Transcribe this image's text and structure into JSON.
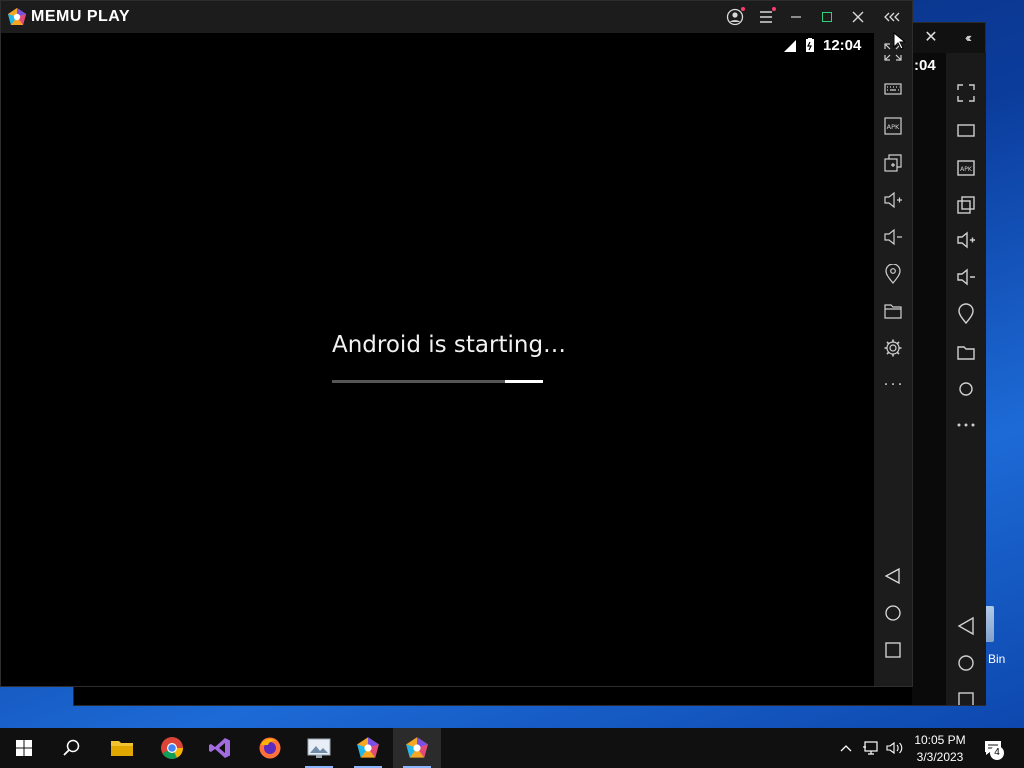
{
  "window": {
    "title": "MEMU PLAY",
    "buttons": {
      "account": "account-icon",
      "menu": "menu-icon",
      "minimize": "minimize-icon",
      "maximize": "maximize-icon",
      "close": "close-icon",
      "collapse": "collapse-icon"
    }
  },
  "android": {
    "status_time": "12:04",
    "boot_message": "Android is starting…",
    "boot_progress": 0.82
  },
  "background_window": {
    "status_time": ":04"
  },
  "sidebar": {
    "items": [
      {
        "icon": "fullscreen-icon"
      },
      {
        "icon": "keyboard-icon"
      },
      {
        "icon": "apk-icon",
        "label": "APK"
      },
      {
        "icon": "multi-instance-icon"
      },
      {
        "icon": "volume-up-icon"
      },
      {
        "icon": "volume-down-icon"
      },
      {
        "icon": "location-icon"
      },
      {
        "icon": "folder-icon"
      },
      {
        "icon": "settings-icon"
      },
      {
        "icon": "more-icon"
      }
    ],
    "nav": [
      {
        "icon": "back-icon"
      },
      {
        "icon": "home-icon"
      },
      {
        "icon": "recents-icon"
      }
    ]
  },
  "desktop": {
    "recycle_bin_label": "Bin"
  },
  "taskbar": {
    "apps": [
      "start-icon",
      "search-icon",
      "file-explorer-icon",
      "chrome-icon",
      "visual-studio-icon",
      "firefox-icon",
      "image-viewer-icon",
      "memu-multi-icon",
      "memu-play-icon"
    ],
    "time": "10:05 PM",
    "date": "3/3/2023",
    "notifications": "4"
  }
}
